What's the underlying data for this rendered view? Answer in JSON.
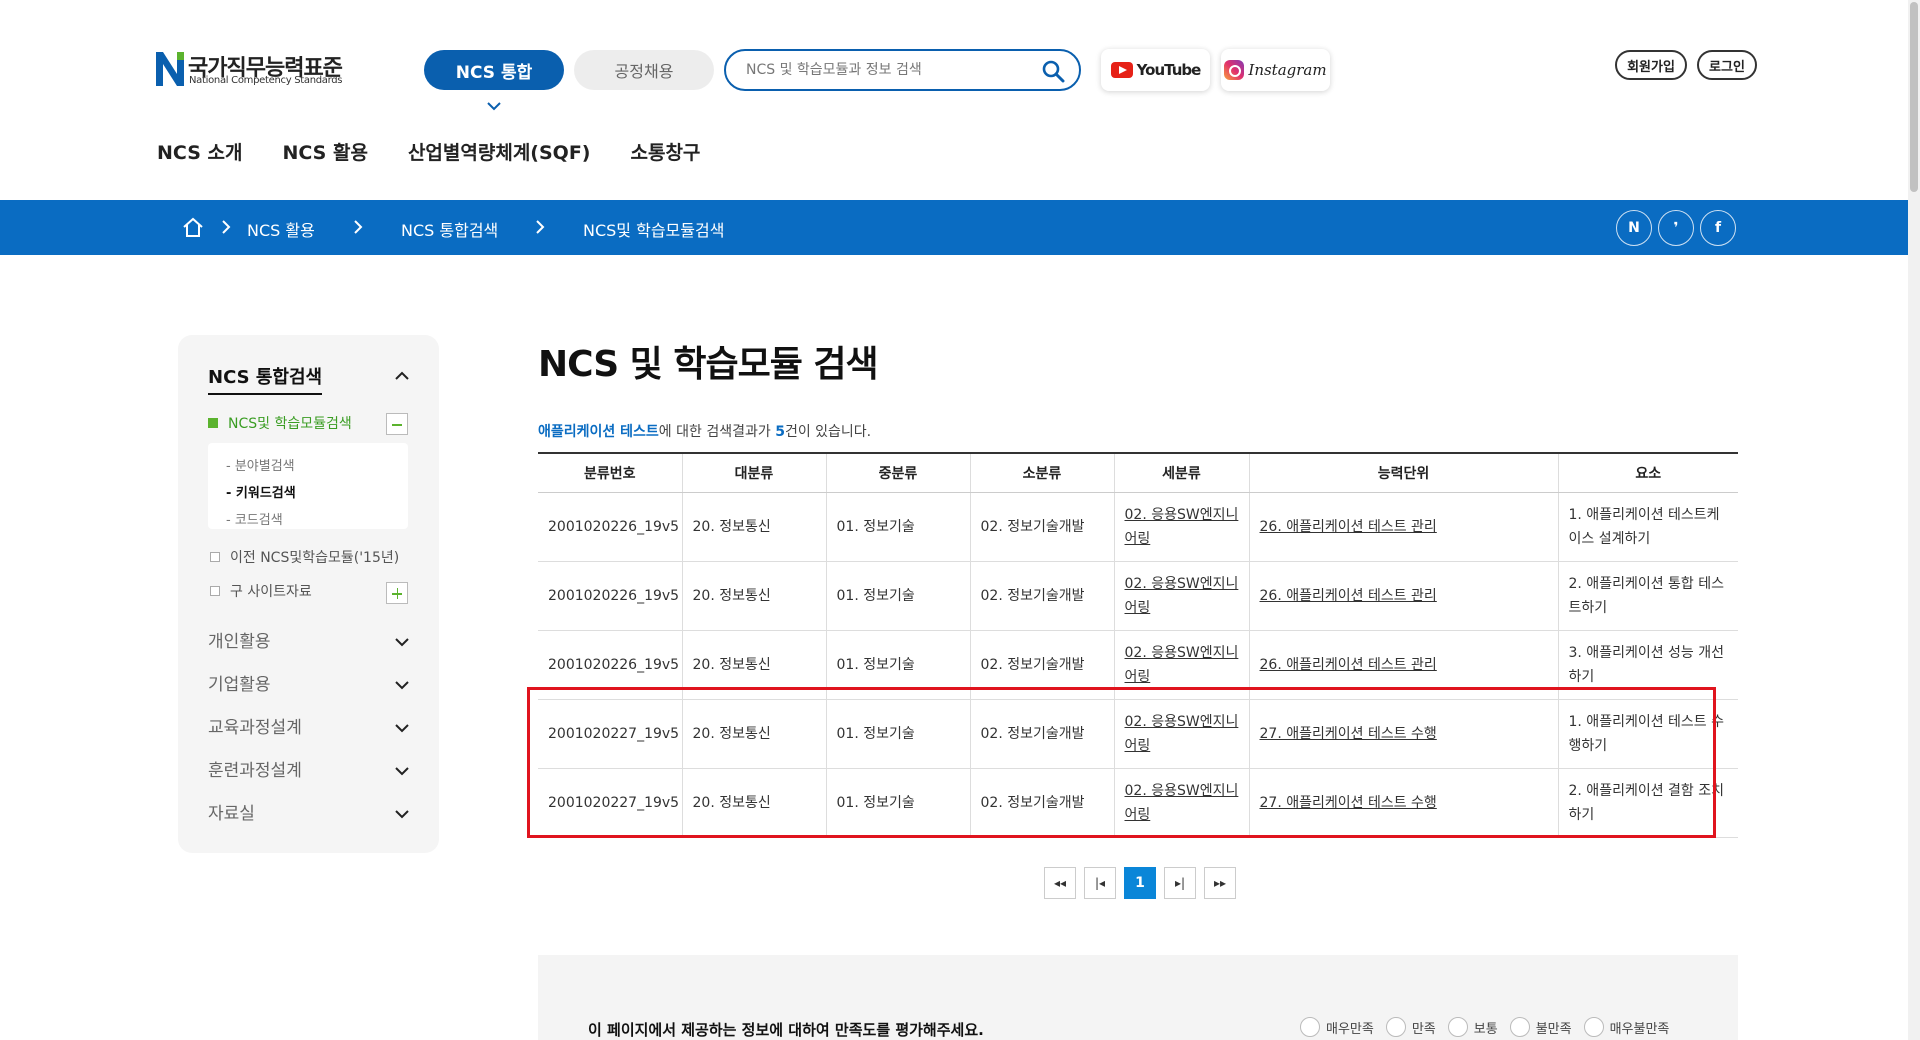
{
  "header": {
    "logo_title": "국가직무능력표준",
    "logo_sub": "National Competency Standards",
    "ncs_button": "NCS 통합",
    "recruit_button": "공정채용",
    "search_placeholder": "NCS 및 학습모듈과 정보 검색",
    "youtube_label": "YouTube",
    "instagram_label": "Instagram",
    "join_button": "회원가입",
    "login_button": "로그인",
    "nav": [
      "NCS 소개",
      "NCS 활용",
      "산업별역량체계(SQF)",
      "소통창구"
    ]
  },
  "breadcrumb": {
    "items": [
      "NCS 활용",
      "NCS 통합검색",
      "NCS및 학습모듈검색"
    ],
    "social": [
      "N",
      "❜",
      "f"
    ]
  },
  "sidebar": {
    "title": "NCS 통합검색",
    "sub_active": "NCS및 학습모듈검색",
    "panel_items": [
      "- 분야별검색",
      "- 키워드검색",
      "- 코드검색"
    ],
    "checks": [
      "이전 NCS및학습모듈('15년)",
      "구 사이트자료"
    ],
    "menus": [
      "개인활용",
      "기업활용",
      "교육과정설계",
      "훈련과정설계",
      "자료실"
    ]
  },
  "main": {
    "title": "NCS 및 학습모듈 검색",
    "result_keyword": "애플리케이션 테스트",
    "result_mid": "에 대한 검색결과가 ",
    "result_count": "5",
    "result_end": "건이 있습니다.",
    "columns": [
      "분류번호",
      "대분류",
      "중분류",
      "소분류",
      "세분류",
      "능력단위",
      "요소"
    ],
    "rows": [
      [
        "2001020226_19v5",
        "20. 정보통신",
        "01. 정보기술",
        "02. 정보기술개발",
        "02. 응용SW엔지니어링",
        "26. 애플리케이션 테스트 관리",
        "1. 애플리케이션 테스트케이스 설계하기"
      ],
      [
        "2001020226_19v5",
        "20. 정보통신",
        "01. 정보기술",
        "02. 정보기술개발",
        "02. 응용SW엔지니어링",
        "26. 애플리케이션 테스트 관리",
        "2. 애플리케이션 통합 테스트하기"
      ],
      [
        "2001020226_19v5",
        "20. 정보통신",
        "01. 정보기술",
        "02. 정보기술개발",
        "02. 응용SW엔지니어링",
        "26. 애플리케이션 테스트 관리",
        "3. 애플리케이션 성능 개선하기"
      ],
      [
        "2001020227_19v5",
        "20. 정보통신",
        "01. 정보기술",
        "02. 정보기술개발",
        "02. 응용SW엔지니어링",
        "27. 애플리케이션 테스트 수행",
        "1. 애플리케이션 테스트 수행하기"
      ],
      [
        "2001020227_19v5",
        "20. 정보통신",
        "01. 정보기술",
        "02. 정보기술개발",
        "02. 응용SW엔지니어링",
        "27. 애플리케이션 테스트 수행",
        "2. 애플리케이션 결함 조치하기"
      ]
    ]
  },
  "pagination": {
    "first": "◂◂",
    "prev": "|◂",
    "current": "1",
    "next": "▸|",
    "last": "▸▸"
  },
  "survey": {
    "question": "이 페이지에서 제공하는 정보에 대하여 만족도를 평가해주세요.",
    "options": [
      "매우만족",
      "만족",
      "보통",
      "불만족",
      "매우불만족"
    ]
  },
  "colors": {
    "brand_blue": "#0a5fae",
    "crumb_blue": "#0a6cc2",
    "active_green": "#3a9d23",
    "highlight_red": "#e0141e"
  }
}
